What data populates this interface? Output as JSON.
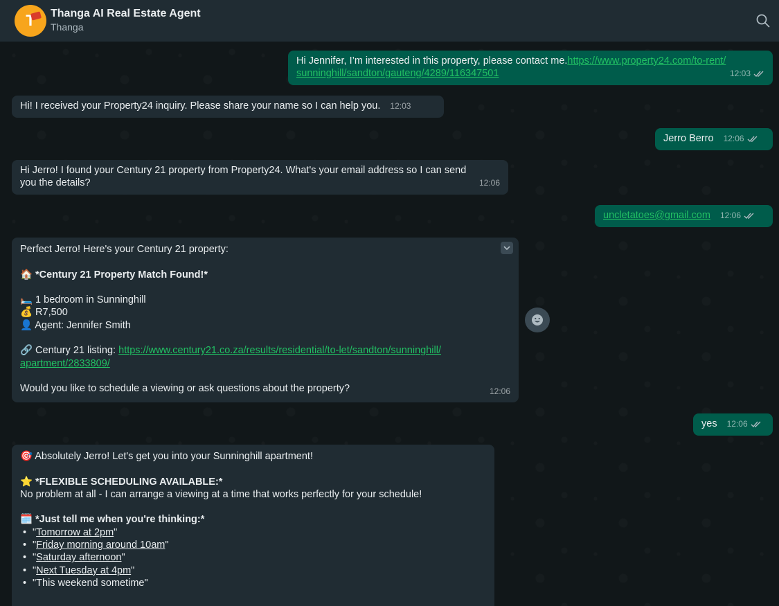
{
  "header": {
    "title": "Thanga AI Real Estate Agent",
    "subtitle": "Thanga",
    "avatar_letter": "T"
  },
  "messages": {
    "m1": {
      "text": "Hi Jennifer, I’m interested in this property, please contact me.",
      "link1": "https://www.property24.com/to-rent/",
      "link2": "sunninghill/sandton/gauteng/4289/116347501",
      "time": "12:03"
    },
    "m2": {
      "text": "Hi! I received your Property24 inquiry. Please share your name so I can help you.",
      "time": "12:03"
    },
    "m3": {
      "text": "Jerro Berro",
      "time": "12:06"
    },
    "m4": {
      "line1": "Hi Jerro! I found your Century 21 property from Property24. What's your email address so I can send",
      "line2": "you the details?",
      "time": "12:06"
    },
    "m5": {
      "text": "uncletatoes@gmail.com",
      "time": "12:06"
    },
    "m6": {
      "intro": "Perfect Jerro! Here's your Century 21 property:",
      "heading_emoji": "🏠",
      "heading": "*Century 21 Property Match Found!*",
      "bed_emoji": "🛏️",
      "bed": "1 bedroom in Sunninghill",
      "price_emoji": "💰",
      "price": "R7,500",
      "agent_emoji": "👤",
      "agent": "Agent: Jennifer Smith",
      "listing_emoji": "🔗",
      "listing_label": "Century 21 listing:",
      "listing_link1": "https://www.century21.co.za/results/residential/to-let/sandton/sunninghill/",
      "listing_link2": "apartment/2833809/",
      "question": "Would you like to schedule a viewing or ask questions about the property?",
      "time": "12:06"
    },
    "m7": {
      "text": "yes",
      "time": "12:06"
    },
    "m8": {
      "intro_emoji": "🎯",
      "intro": "Absolutely Jerro! Let's get you into your Sunninghill apartment!",
      "flex_emoji": "⭐",
      "flex_heading": "*FLEXIBLE SCHEDULING AVAILABLE:*",
      "flex_text": "No problem at all - I can arrange a viewing at a time that works perfectly for your schedule!",
      "cal_emoji": "🗓️",
      "cal_heading": "*Just tell me when you're thinking:*",
      "options": [
        "Tomorrow at 2pm",
        "Friday morning around 10am",
        "Saturday afternoon",
        "Next Tuesday at 4pm",
        "This weekend sometime"
      ]
    }
  },
  "colors": {
    "header_bg": "#202c33",
    "incoming_bubble": "#202c33",
    "outgoing_bubble": "#005c4b",
    "link": "#53bdeb",
    "avatar": "#f7a51c"
  },
  "icons": [
    "search-icon",
    "double-check-icon",
    "chevron-down-icon",
    "emoji-react-icon"
  ]
}
